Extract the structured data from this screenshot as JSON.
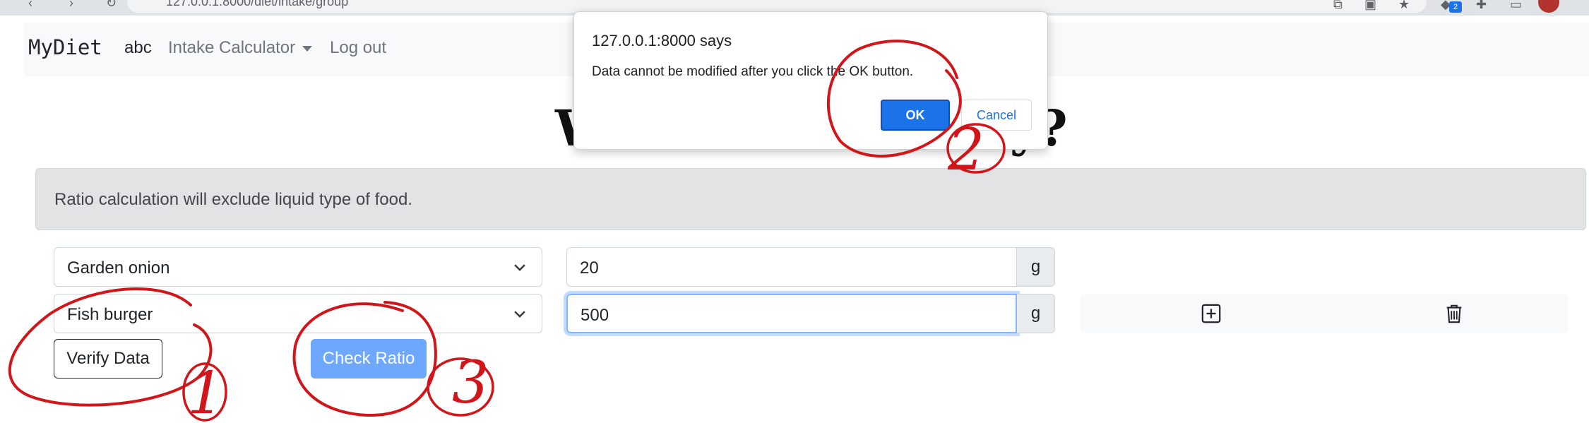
{
  "browser": {
    "url": "127.0.0.1:8000/diet/intake/group",
    "extension_badge": "2"
  },
  "navbar": {
    "brand": "MyDiet",
    "user": "abc",
    "calculator_menu": "Intake Calculator",
    "logout": "Log out"
  },
  "page": {
    "title_left": "W",
    "title_right": "y?"
  },
  "alert": {
    "text": "Ratio calculation will exclude liquid type of food."
  },
  "rows": [
    {
      "food": "Garden onion",
      "amount": "20",
      "unit": "g"
    },
    {
      "food": "Fish burger",
      "amount": "500",
      "unit": "g"
    }
  ],
  "buttons": {
    "verify": "Verify Data",
    "check": "Check Ratio"
  },
  "dialog": {
    "title": "127.0.0.1:8000 says",
    "message": "Data cannot be modified after you click the OK button.",
    "ok": "OK",
    "cancel": "Cancel"
  },
  "annotations": {
    "color": "#d0161b",
    "step_verify": "1",
    "step_ok": "2",
    "step_check": "3"
  },
  "colors": {
    "primary": "#0d6efd",
    "primary_disabled": "#6ea8fe",
    "dialog_ok": "#1a73e8",
    "alert_bg": "#e2e3e5"
  }
}
